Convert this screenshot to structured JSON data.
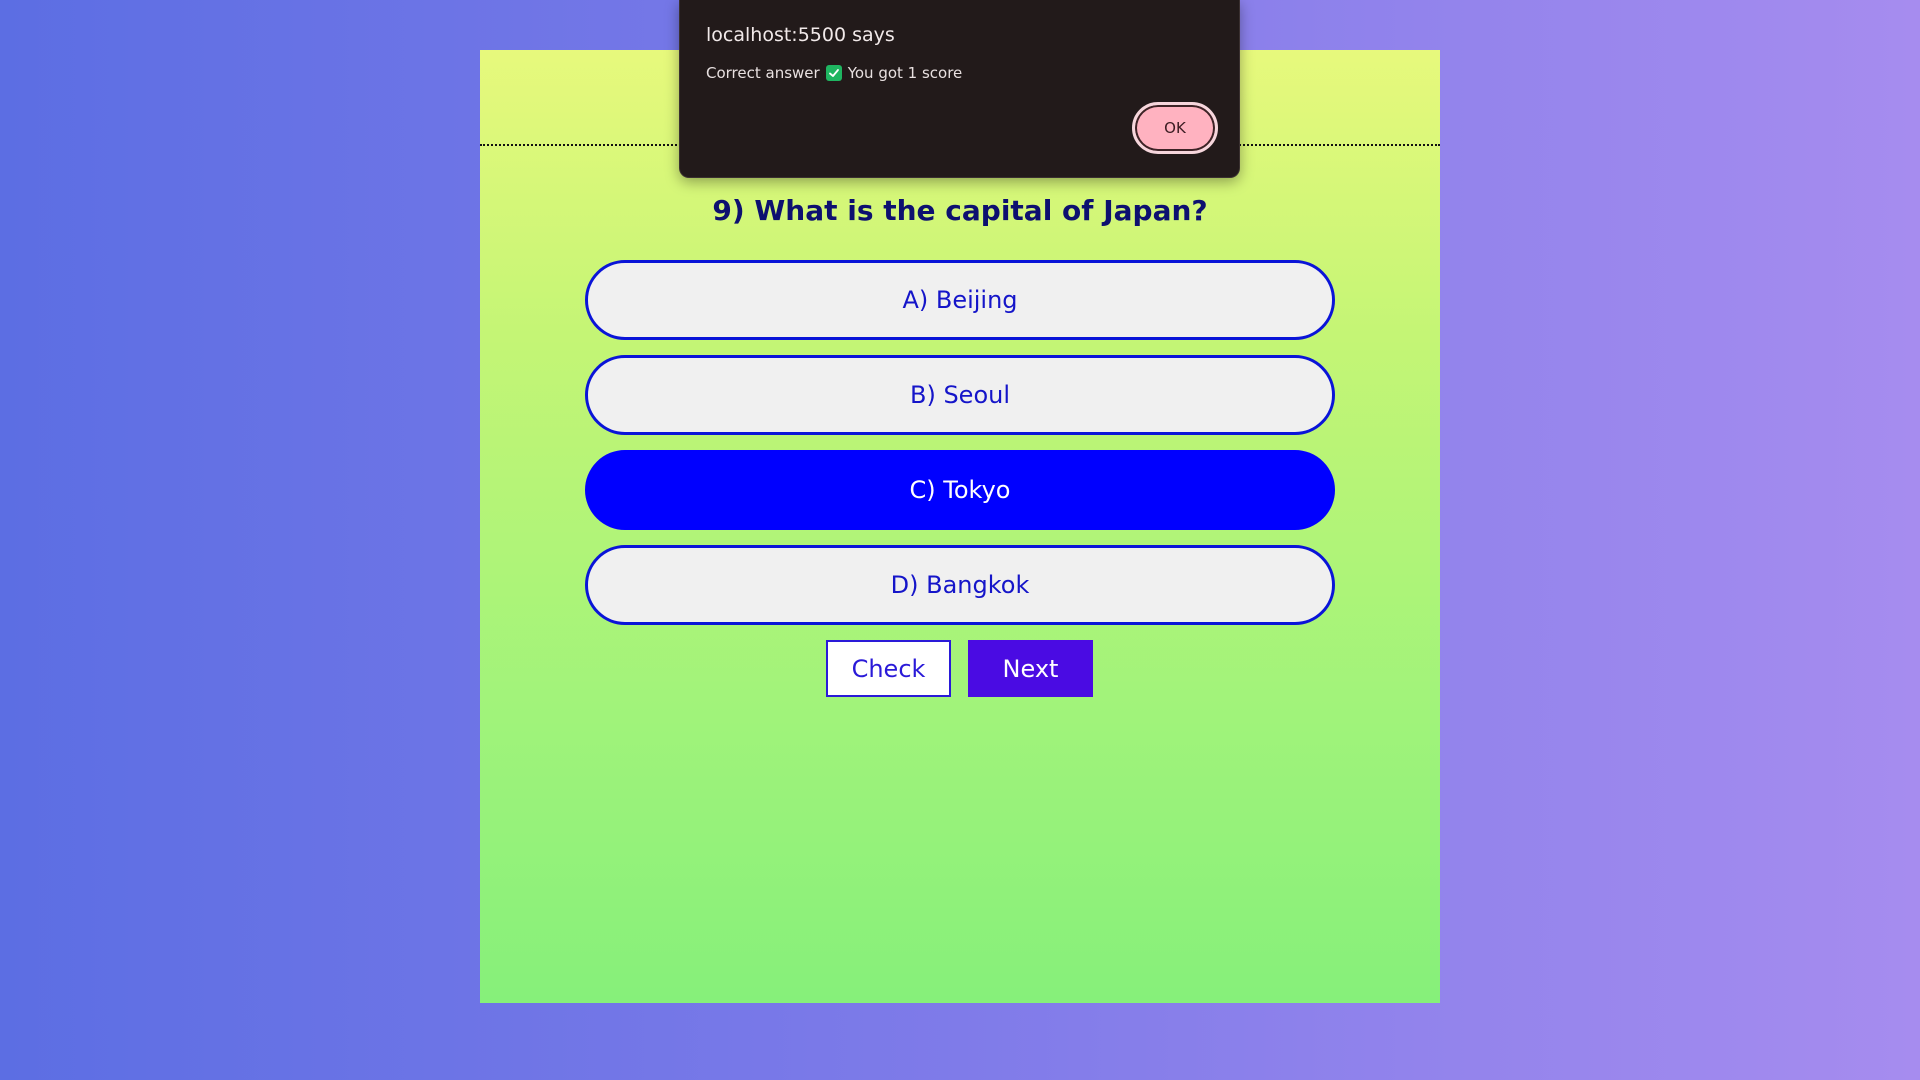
{
  "dialog": {
    "title": "localhost:5500 says",
    "message_before": "Correct answer",
    "message_after": "You got 1 score",
    "ok_label": "OK"
  },
  "quiz": {
    "question": "9) What is the capital of Japan?",
    "options": [
      {
        "label": "A) Beijing",
        "selected": false
      },
      {
        "label": "B) Seoul",
        "selected": false
      },
      {
        "label": "C) Tokyo",
        "selected": true
      },
      {
        "label": "D) Bangkok",
        "selected": false
      }
    ],
    "check_label": "Check",
    "next_label": "Next"
  },
  "colors": {
    "accent": "#0000ff",
    "next_button": "#4a0be3",
    "question_text": "#0d1070"
  },
  "icons": {
    "dialog_check": "check-mark-icon"
  }
}
